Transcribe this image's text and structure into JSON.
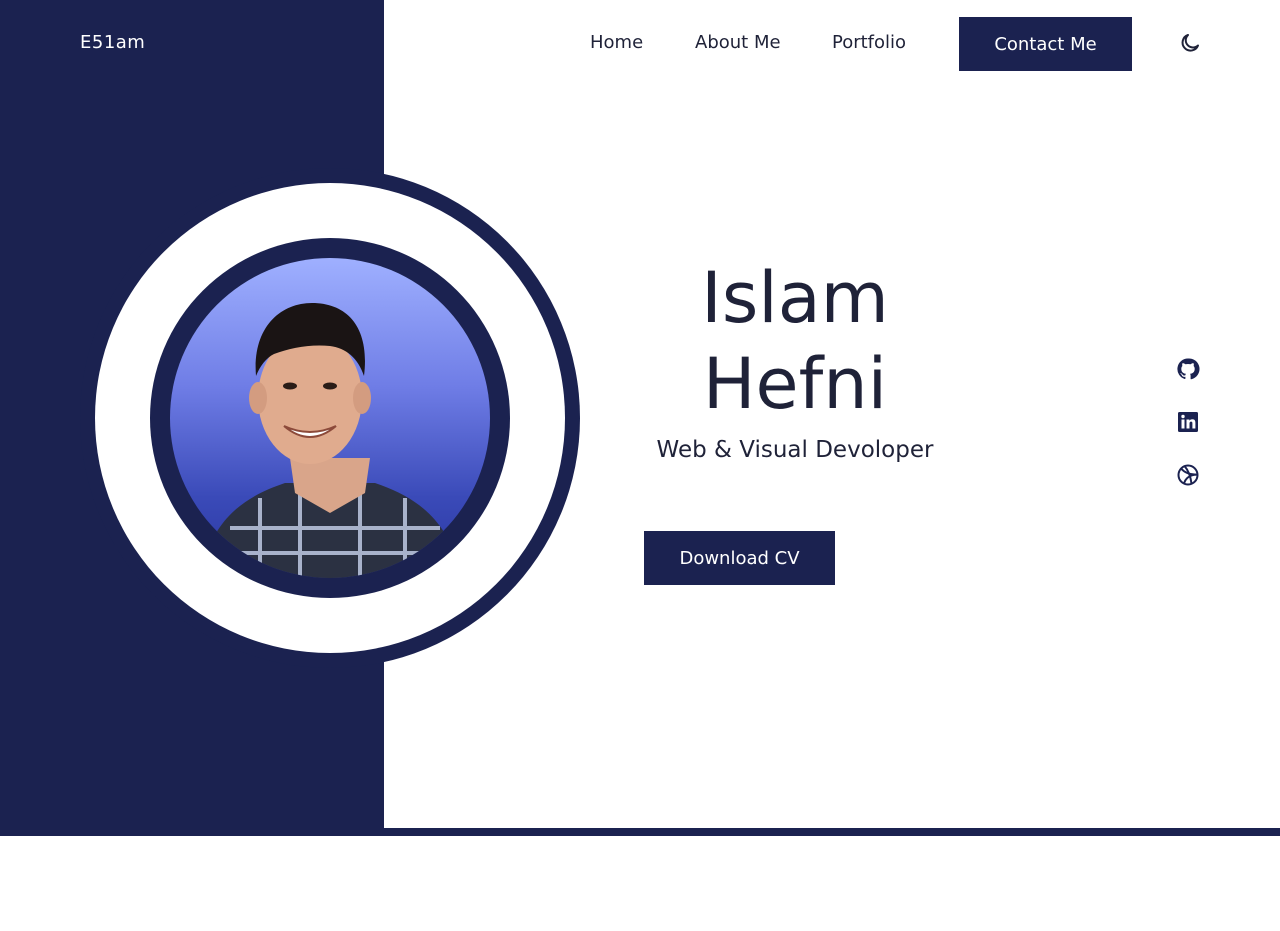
{
  "brand": {
    "logo": "E51am"
  },
  "nav": {
    "items": [
      {
        "label": "Home"
      },
      {
        "label": "About Me"
      },
      {
        "label": "Portfolio"
      }
    ],
    "contact_label": "Contact Me",
    "theme_icon": "moon-icon"
  },
  "hero": {
    "first_name": "Islam",
    "last_name": "Hefni",
    "subtitle": "Web & Visual Devoloper",
    "download_label": "Download CV",
    "photo": "profile-photo"
  },
  "social": {
    "icons": [
      "github-icon",
      "linkedin-icon",
      "dribbble-icon"
    ]
  },
  "colors": {
    "primary": "#1b2250",
    "text": "#1f2238",
    "background": "#ffffff",
    "photo_gradient_top": "#9fb0ff",
    "photo_gradient_bottom": "#2a36a0"
  }
}
